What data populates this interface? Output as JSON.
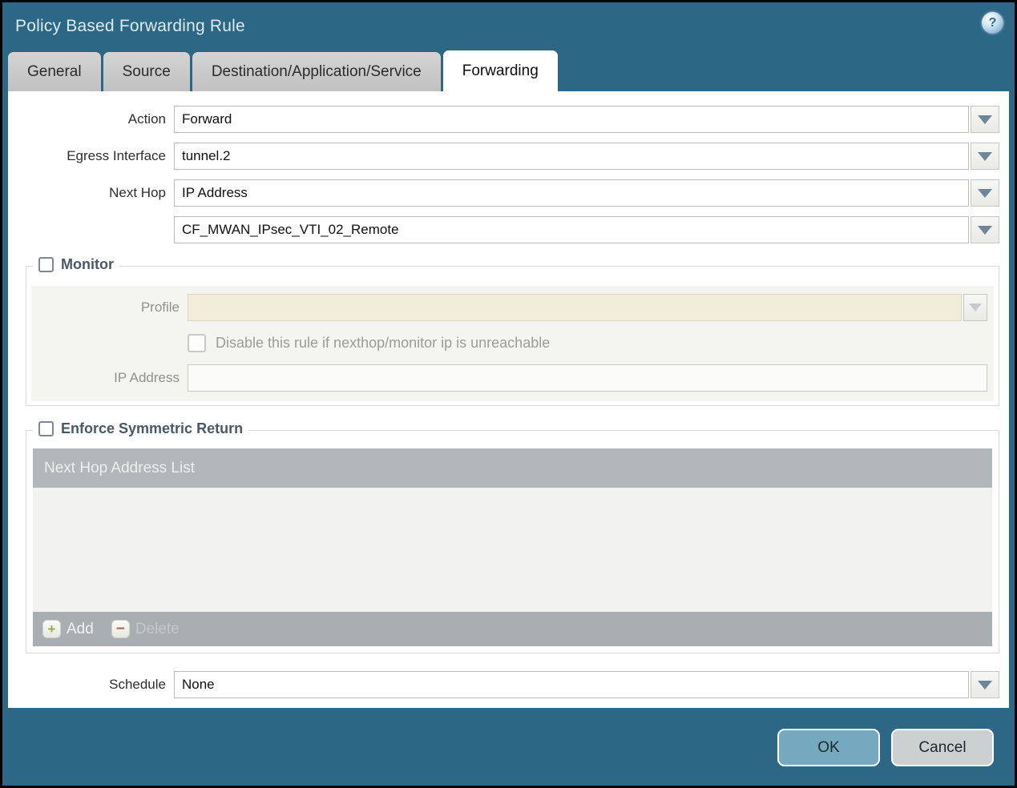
{
  "window": {
    "title": "Policy Based Forwarding Rule",
    "help_icon_glyph": "?"
  },
  "tabs": [
    {
      "label": "General",
      "active": false
    },
    {
      "label": "Source",
      "active": false
    },
    {
      "label": "Destination/Application/Service",
      "active": false
    },
    {
      "label": "Forwarding",
      "active": true
    }
  ],
  "form": {
    "action": {
      "label": "Action",
      "value": "Forward"
    },
    "egress_interface": {
      "label": "Egress Interface",
      "value": "tunnel.2"
    },
    "next_hop": {
      "label": "Next Hop",
      "value": "IP Address"
    },
    "next_hop_address": {
      "value": "CF_MWAN_IPsec_VTI_02_Remote"
    },
    "schedule": {
      "label": "Schedule",
      "value": "None"
    }
  },
  "monitor": {
    "title": "Monitor",
    "checked": false,
    "profile": {
      "label": "Profile",
      "value": ""
    },
    "disable_rule_checkbox": {
      "label": "Disable this rule if nexthop/monitor ip is unreachable",
      "checked": false
    },
    "ip_address": {
      "label": "IP Address",
      "value": ""
    }
  },
  "symmetric_return": {
    "title": "Enforce Symmetric Return",
    "checked": false,
    "table": {
      "header": "Next Hop Address List",
      "rows": []
    },
    "add_label": "Add",
    "delete_label": "Delete",
    "add_icon_glyph": "+",
    "delete_icon_glyph": "−"
  },
  "footer": {
    "ok_label": "OK",
    "cancel_label": "Cancel"
  },
  "colors": {
    "titlebar_teal": "#2d6786",
    "active_tab_bg": "#ffffff",
    "inactive_tab_bg": "#c6c6c6",
    "profile_disabled_bg": "#f2ecda",
    "table_header_gray": "#b2b7ba",
    "toolbar_gray": "#a9aeb2",
    "ok_button_bg": "#74a9c0",
    "cancel_button_bg": "#cdd0d0",
    "add_plus_green": "#9aab45",
    "delete_minus_red": "#a86458",
    "dropdown_arrow": "#6d8799"
  }
}
